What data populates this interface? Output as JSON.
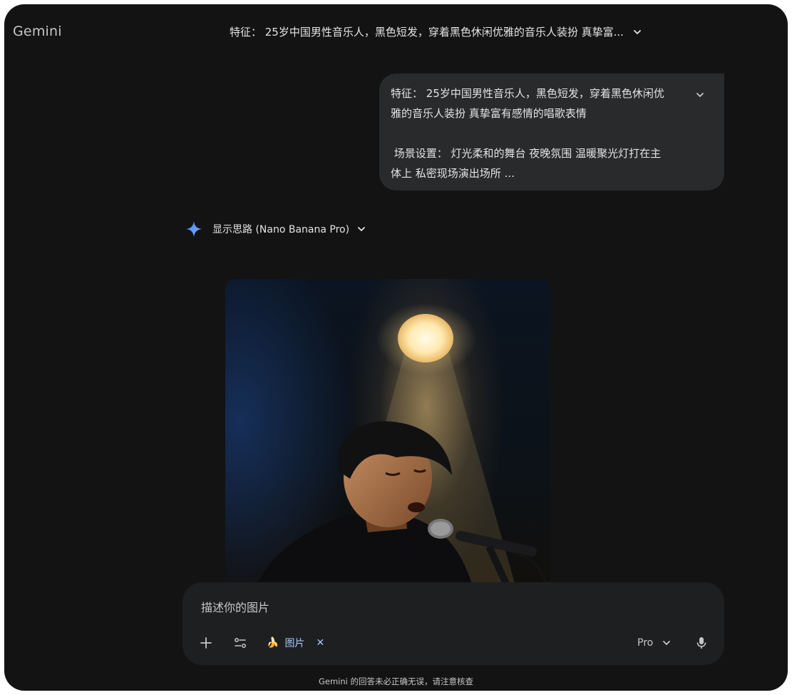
{
  "app": {
    "title": "Gemini"
  },
  "conversation": {
    "title": "特征： 25岁中国男性音乐人，黑色短发，穿着黑色休闲优雅的音乐人装扮 真挚富..."
  },
  "user_prompt": {
    "line1": "特征： 25岁中国男性音乐人，黑色短发，穿着黑色休闲优",
    "line2": "雅的音乐人装扮 真挚富有感情的唱歌表情",
    "line3": " 场景设置： 灯光柔和的舞台 夜晚氛围 温暖聚光灯打在主",
    "line4": "体上 私密现场演出场所 ..."
  },
  "response": {
    "thinking_label": "显示思路 (Nano Banana Pro)"
  },
  "composer": {
    "placeholder": "描述你的图片",
    "chip_label": "图片",
    "chip_emoji": "🍌",
    "chip_remove": "✕",
    "model_label": "Pro"
  },
  "footer": {
    "disclaimer": "Gemini 的回答未必正确无误，请注意核查"
  },
  "colors": {
    "window_bg": "#131313",
    "bubble_bg": "#282a2c",
    "composer_bg": "#1e1f20",
    "accent": "#a8c7fa",
    "sparkle": "#4f8cf6"
  },
  "icons": [
    "chevron-down-icon",
    "sparkle-icon",
    "plus-icon",
    "tools-icon",
    "banana-icon",
    "close-icon",
    "mic-icon"
  ]
}
